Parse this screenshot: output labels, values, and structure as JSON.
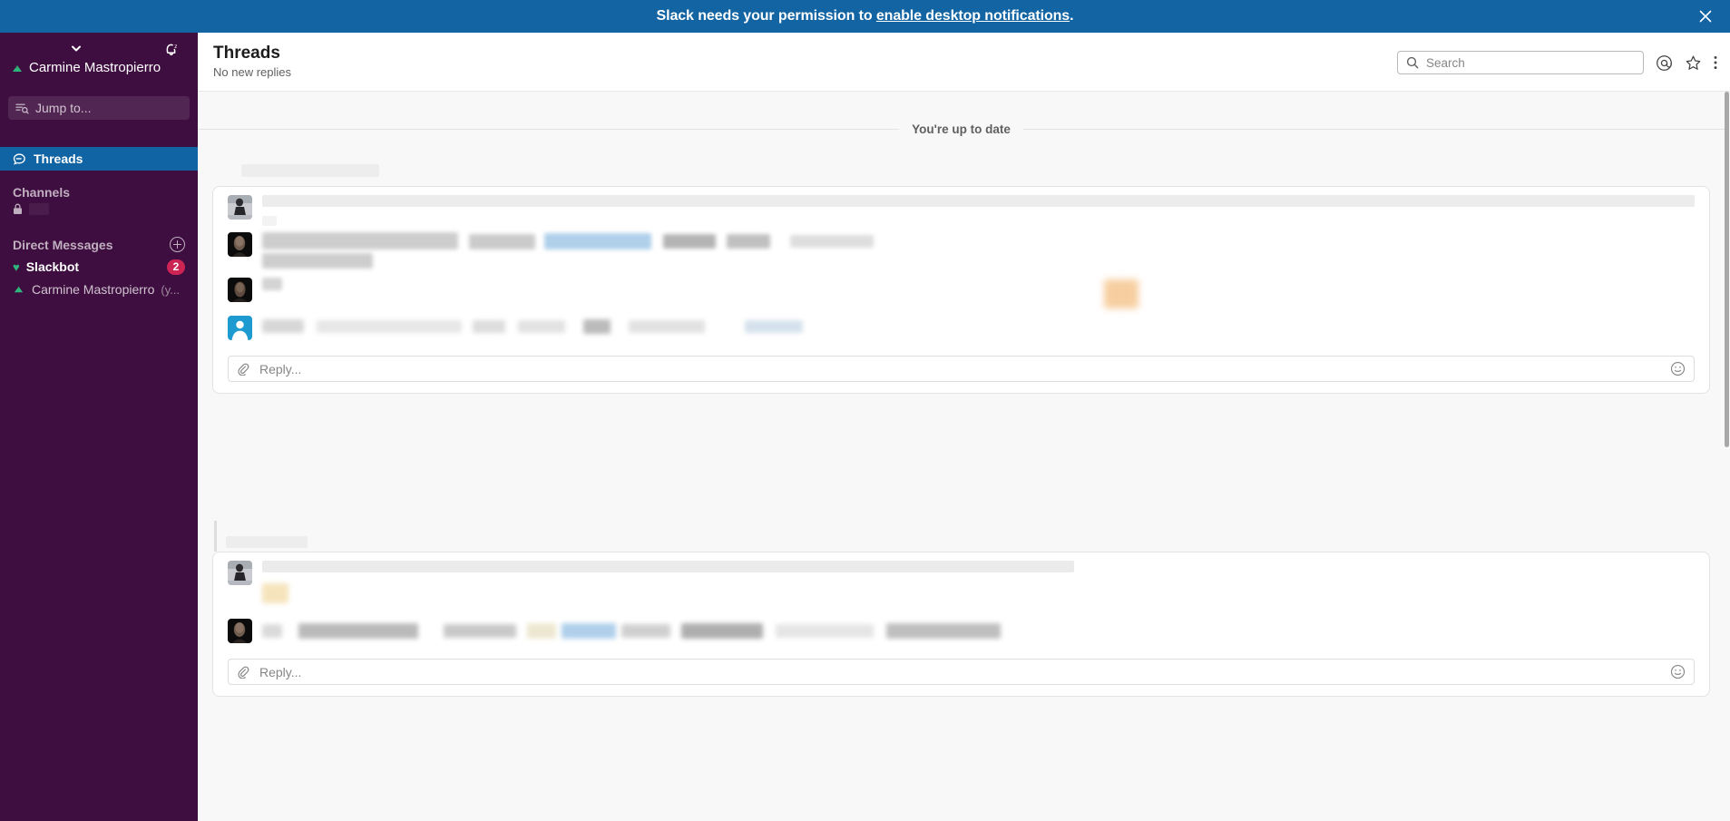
{
  "banner": {
    "text_before": "Slack needs your permission to ",
    "link": "enable desktop notifications",
    "text_after": ".",
    "close_icon": "close-icon",
    "background": "#1264A3"
  },
  "sidebar": {
    "background": "#3F0E40",
    "team_name": "Carmine Mastropierro",
    "chevron_icon": "chevron-down-icon",
    "bell_icon": "bell-snooze-icon",
    "presence_icon": "away-flag-icon",
    "jump_to": {
      "label": "Jump to...",
      "icon": "jump-to-search-icon"
    },
    "nav": [
      {
        "label": "Threads",
        "icon": "threads-icon",
        "active": true
      }
    ],
    "sections": [
      {
        "label": "Channels"
      },
      {
        "label": "Direct Messages"
      }
    ],
    "channels_redacted_icon": "lock-icon",
    "direct_messages": [
      {
        "name": "Slackbot",
        "icon": "heart-icon",
        "badge": "2",
        "unread": true,
        "suffix": ""
      },
      {
        "name": "Carmine Mastropierro",
        "icon": "away-flag-icon",
        "badge": "",
        "unread": false,
        "suffix": "(y..."
      }
    ],
    "add_dm_icon": "plus-circle-icon",
    "badge_color": "#CD2553",
    "active_color": "#1164A3"
  },
  "header": {
    "title": "Threads",
    "subtitle": "No new replies",
    "search": {
      "placeholder": "Search",
      "icon": "search-icon"
    },
    "icons": [
      {
        "name": "mentions-at-icon"
      },
      {
        "name": "star-outline-icon"
      },
      {
        "name": "more-kebab-icon"
      }
    ]
  },
  "main": {
    "up_to_date_label": "You're up to date",
    "threads": [
      {
        "id": "thread-1",
        "header_redacted": true,
        "messages": [
          {
            "avatar": "photo-person-standing",
            "redacted": true
          },
          {
            "avatar": "photo-person-dark-1",
            "redacted": true
          },
          {
            "avatar": "photo-person-dark-2",
            "redacted": true
          },
          {
            "avatar": "slackbot-default-blue",
            "redacted": true
          }
        ],
        "reply": {
          "placeholder": "Reply...",
          "attach_icon": "paperclip-icon",
          "emoji_icon": "emoji-smiley-icon"
        }
      },
      {
        "id": "thread-2",
        "header_redacted": true,
        "messages": [
          {
            "avatar": "photo-person-standing",
            "redacted": true
          },
          {
            "avatar": "photo-person-dark-1",
            "redacted": true
          }
        ],
        "reply": {
          "placeholder": "Reply...",
          "attach_icon": "paperclip-icon",
          "emoji_icon": "emoji-smiley-icon"
        }
      }
    ]
  },
  "scrollbar": {
    "name": "main-scrollbar"
  }
}
